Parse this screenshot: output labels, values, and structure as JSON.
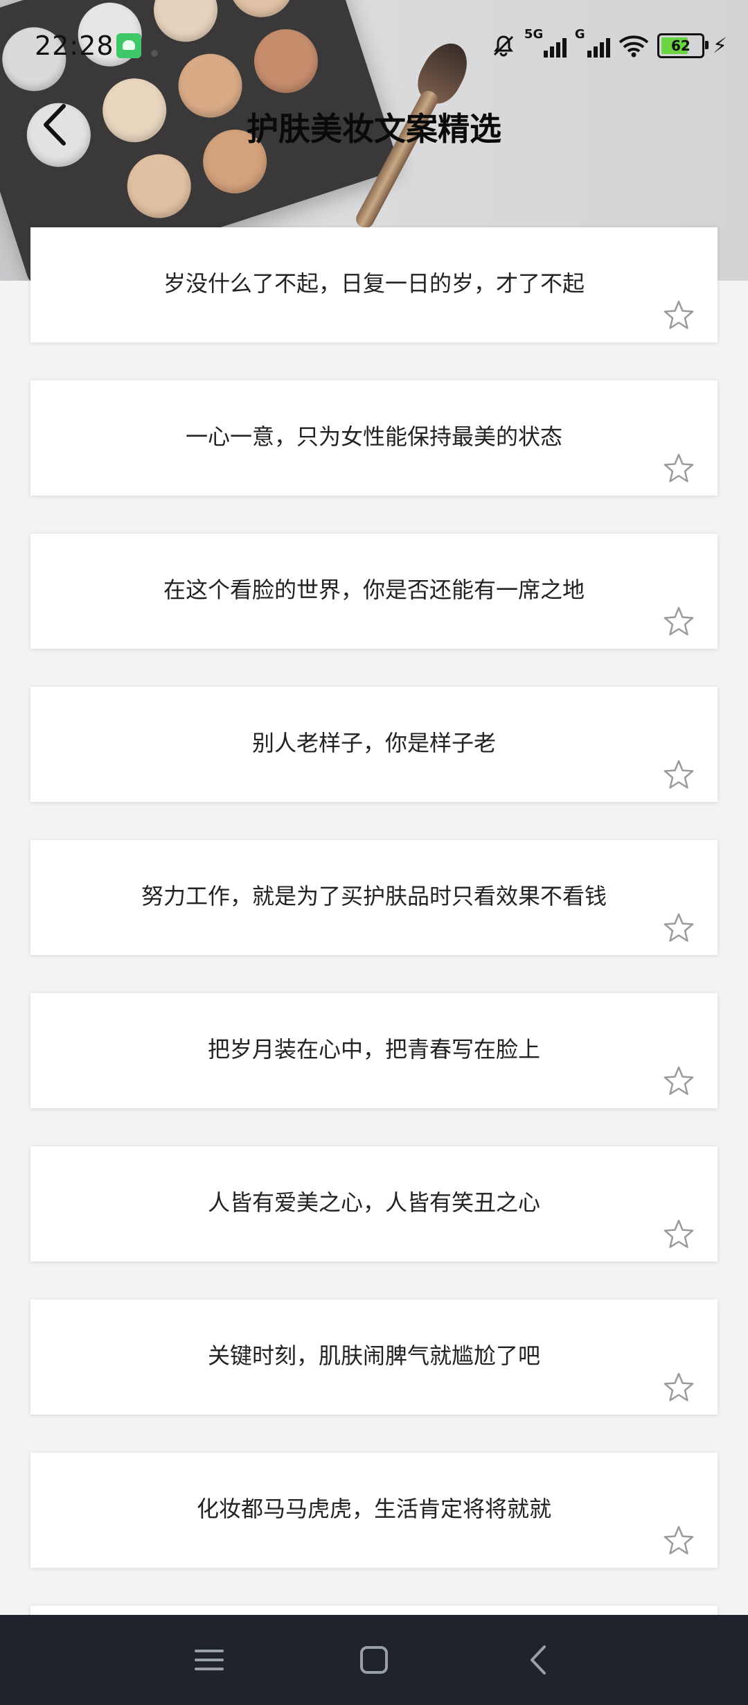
{
  "status_bar": {
    "time": "22:28",
    "signal1_label": "5G",
    "signal2_label": "G",
    "battery_level": "62"
  },
  "header": {
    "title": "护肤美妆文案精选"
  },
  "quotes": [
    {
      "text": "岁没什么了不起，日复一日的岁，才了不起"
    },
    {
      "text": "一心一意，只为女性能保持最美的状态"
    },
    {
      "text": "在这个看脸的世界，你是否还能有一席之地"
    },
    {
      "text": "别人老样子，你是样子老"
    },
    {
      "text": "努力工作，就是为了买护肤品时只看效果不看钱"
    },
    {
      "text": "把岁月装在心中，把青春写在脸上"
    },
    {
      "text": "人皆有爱美之心，人皆有笑丑之心"
    },
    {
      "text": "关键时刻，肌肤闹脾气就尴尬了吧"
    },
    {
      "text": "化妆都马马虎虎，生活肯定将将就就"
    }
  ],
  "colors": {
    "accent_battery": "#6ad442",
    "navbar": "#1f232b"
  }
}
